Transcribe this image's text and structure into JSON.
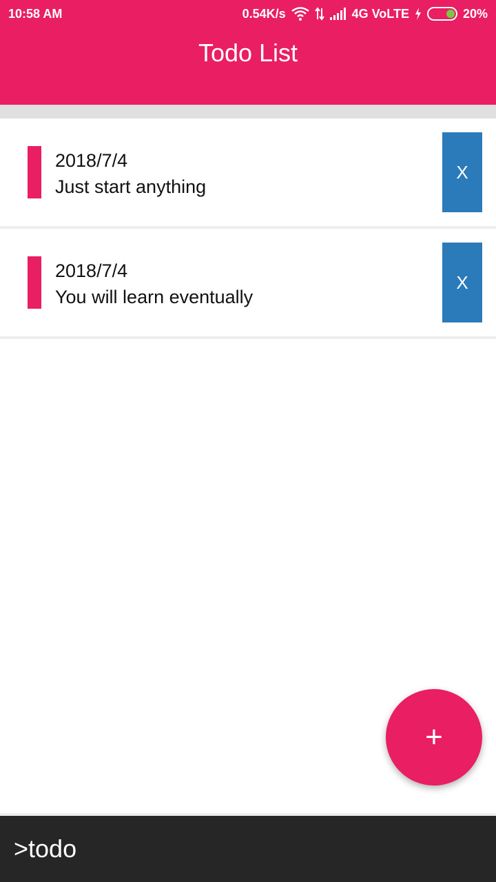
{
  "status_bar": {
    "time": "10:58 AM",
    "speed": "0.54K/s",
    "network": "4G VoLTE",
    "battery": "20%",
    "icons": [
      "wifi-icon",
      "data-arrows-icon",
      "signal-icon",
      "charging-icon",
      "battery-icon"
    ]
  },
  "app_bar": {
    "title": "Todo List"
  },
  "todos": [
    {
      "date": "2018/7/4",
      "text": "Just start anything",
      "delete_label": "X"
    },
    {
      "date": "2018/7/4",
      "text": "You will learn eventually",
      "delete_label": "X"
    }
  ],
  "fab": {
    "label": "+"
  },
  "footer": {
    "text": ">todo"
  },
  "colors": {
    "primary": "#e91e63",
    "delete_button": "#2b7bba",
    "footer_bg": "#262626",
    "battery_fill": "#7ac943"
  }
}
